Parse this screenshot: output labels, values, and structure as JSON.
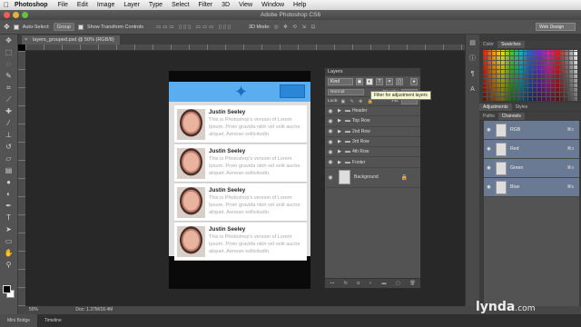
{
  "menubar": {
    "app": "Photoshop",
    "items": [
      "File",
      "Edit",
      "Image",
      "Layer",
      "Type",
      "Select",
      "Filter",
      "3D",
      "View",
      "Window",
      "Help"
    ]
  },
  "titlebar": {
    "title": "Adobe Photoshop CS6"
  },
  "options": {
    "auto_select_label": "Auto-Select:",
    "auto_select_value": "Group",
    "transform_label": "Show Transform Controls",
    "mode_label": "3D Mode:",
    "workspace": "Web Design"
  },
  "document": {
    "tab_title": "layers_grouped.psd @ 50% (RGB/8)"
  },
  "status": {
    "zoom": "50%",
    "doc": "Doc: 1.37M/18.4M"
  },
  "bottom_tabs": [
    "Mini Bridge",
    "Timeline"
  ],
  "canvas": {
    "cards": [
      {
        "name": "Justin Seeley",
        "text": "This is Photoshop's version of Lorem Ipsum. Proin gravida nibh vel velit auctor aliquet. Aenean sollicitudin."
      },
      {
        "name": "Justin Seeley",
        "text": "This is Photoshop's version of Lorem Ipsum. Proin gravida nibh vel velit auctor aliquet. Aenean sollicitudin."
      },
      {
        "name": "Justin Seeley",
        "text": "This is Photoshop's version of Lorem Ipsum. Proin gravida nibh vel velit auctor aliquet. Aenean sollicitudin."
      },
      {
        "name": "Justin Seeley",
        "text": "This is Photoshop's version of Lorem Ipsum. Proin gravida nibh vel velit auctor aliquet. Aenean sollicitudin."
      }
    ]
  },
  "layers_panel": {
    "title": "Layers",
    "filter_kind": "Kind",
    "blend_mode": "Normal",
    "opacity_label": "Opacity:",
    "lock_label": "Lock:",
    "fill_label": "Fill:",
    "tooltip": "Filter for adjustment layers",
    "layers": [
      "Header",
      "Top Row",
      "2nd Row",
      "3rd Row",
      "4th Row",
      "Footer"
    ],
    "background": "Background"
  },
  "right_dock": {
    "top_tabs": [
      "Color",
      "Swatches"
    ],
    "mid_tabs": [
      "Adjustments",
      "Styles"
    ],
    "lower_tabs": [
      "Paths",
      "Channels"
    ],
    "channels": [
      {
        "name": "RGB",
        "shortcut": "⌘2"
      },
      {
        "name": "Red",
        "shortcut": "⌘3"
      },
      {
        "name": "Green",
        "shortcut": "⌘4"
      },
      {
        "name": "Blue",
        "shortcut": "⌘5"
      }
    ]
  },
  "watermark": {
    "brand": "lynda",
    "suffix": ".com"
  },
  "colors": {
    "accent_blue": "#5aaef0",
    "bar_blue": "#2b86d8"
  }
}
